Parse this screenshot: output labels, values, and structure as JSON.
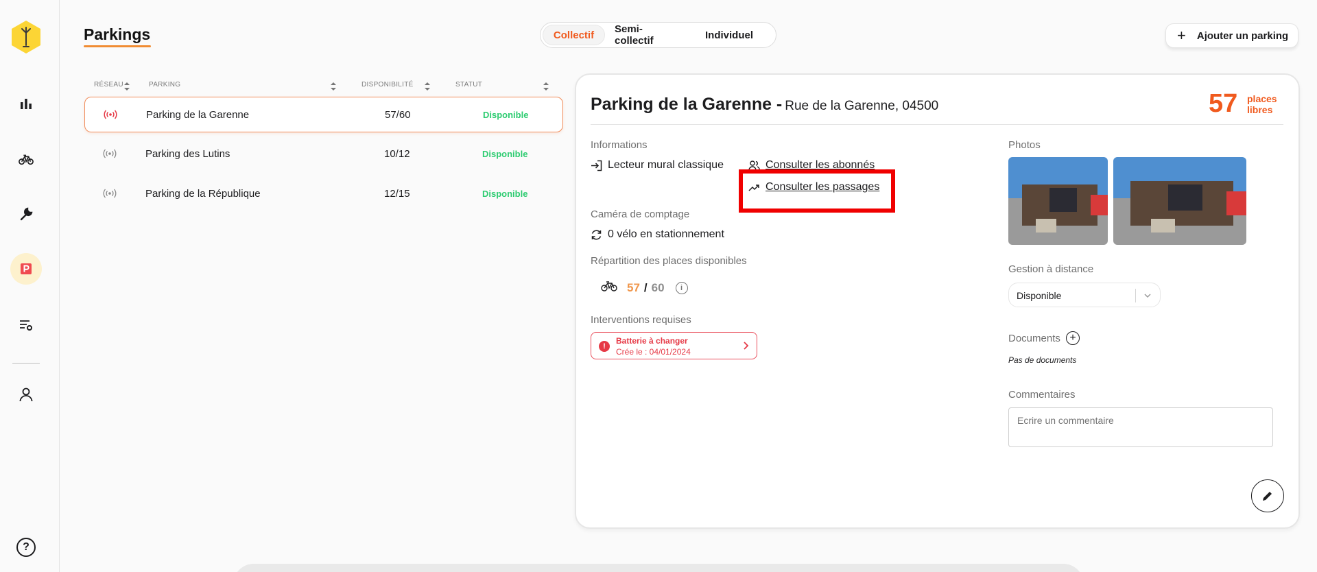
{
  "header": {
    "title": "Parkings",
    "segments": [
      {
        "label": "Collectif",
        "active": true
      },
      {
        "label": "Semi-collectif",
        "active": false
      },
      {
        "label": "Individuel",
        "active": false
      }
    ],
    "add_button": "Ajouter un parking"
  },
  "table": {
    "columns": [
      "RÉSEAU",
      "PARKING",
      "DISPONIBILITÉ",
      "STATUT"
    ],
    "rows": [
      {
        "name": "Parking de la Garenne",
        "availability": "57/60",
        "status": "Disponible",
        "selected": true
      },
      {
        "name": "Parking des Lutins",
        "availability": "10/12",
        "status": "Disponible",
        "selected": false
      },
      {
        "name": "Parking de la République",
        "availability": "12/15",
        "status": "Disponible",
        "selected": false
      }
    ]
  },
  "detail": {
    "title": "Parking de la Garenne -",
    "address": "Rue de la Garenne, 04500",
    "places_count": "57",
    "places_label_1": "places",
    "places_label_2": "libres",
    "info_label": "Informations",
    "reader": "Lecteur mural classique",
    "link_subscribers": "Consulter les abonnés",
    "link_passages": "Consulter les passages",
    "camera_label": "Caméra de comptage",
    "camera_value": "0 vélo en stationnement",
    "repartition_label": "Répartition des places disponibles",
    "free": "57",
    "total": "60",
    "separator": "/",
    "interventions_label": "Interventions requises",
    "intervention_title": "Batterie à changer",
    "intervention_date": "Crée le : 04/01/2024",
    "photos_label": "Photos",
    "remote_label": "Gestion à distance",
    "remote_value": "Disponible",
    "documents_label": "Documents",
    "no_documents": "Pas de documents",
    "comments_label": "Commentaires",
    "comment_placeholder": "Ecrire un commentaire"
  },
  "colors": {
    "accent": "#f05a1e",
    "status_ok": "#2ecc71",
    "alert": "#e63946",
    "highlight": "#f00000"
  },
  "icons": {
    "help": "?"
  }
}
